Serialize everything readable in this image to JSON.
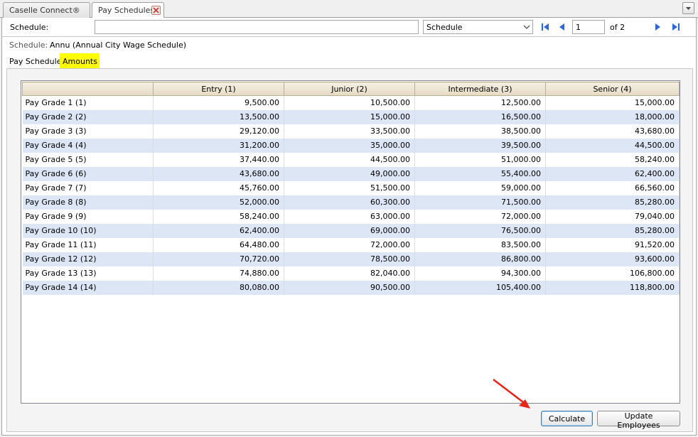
{
  "tabs": [
    {
      "label": "Caselle Connect®"
    },
    {
      "label": "Pay Schedules"
    }
  ],
  "toolbar": {
    "schedule_label": "Schedule:",
    "schedule_input_value": "",
    "search_field_value": "Schedule",
    "page_number": "1",
    "page_total": "of 2"
  },
  "info": {
    "schedule_label": "Schedule:",
    "schedule_value": "Annu (Annual City Wage Schedule)"
  },
  "inner_tabs": [
    {
      "label": "Pay Schedule"
    },
    {
      "label": "Amounts"
    }
  ],
  "grid": {
    "columns": [
      "",
      "Entry (1)",
      "Junior (2)",
      "Intermediate (3)",
      "Senior (4)"
    ],
    "rows": [
      [
        "Pay Grade 1 (1)",
        "9,500.00",
        "10,500.00",
        "12,500.00",
        "15,000.00"
      ],
      [
        "Pay Grade 2 (2)",
        "13,500.00",
        "15,000.00",
        "16,500.00",
        "18,000.00"
      ],
      [
        "Pay Grade 3 (3)",
        "29,120.00",
        "33,500.00",
        "38,500.00",
        "43,680.00"
      ],
      [
        "Pay Grade 4 (4)",
        "31,200.00",
        "35,000.00",
        "39,500.00",
        "44,500.00"
      ],
      [
        "Pay Grade 5 (5)",
        "37,440.00",
        "44,500.00",
        "51,000.00",
        "58,240.00"
      ],
      [
        "Pay Grade 6 (6)",
        "43,680.00",
        "49,000.00",
        "55,400.00",
        "62,400.00"
      ],
      [
        "Pay Grade 7 (7)",
        "45,760.00",
        "51,500.00",
        "59,000.00",
        "66,560.00"
      ],
      [
        "Pay Grade 8 (8)",
        "52,000.00",
        "60,300.00",
        "71,500.00",
        "85,280.00"
      ],
      [
        "Pay Grade 9 (9)",
        "58,240.00",
        "63,000.00",
        "72,000.00",
        "79,040.00"
      ],
      [
        "Pay Grade 10 (10)",
        "62,400.00",
        "69,000.00",
        "76,500.00",
        "85,280.00"
      ],
      [
        "Pay Grade 11 (11)",
        "64,480.00",
        "72,000.00",
        "83,500.00",
        "91,520.00"
      ],
      [
        "Pay Grade 12 (12)",
        "70,720.00",
        "78,500.00",
        "86,800.00",
        "93,600.00"
      ],
      [
        "Pay Grade 13 (13)",
        "74,880.00",
        "82,040.00",
        "94,300.00",
        "106,800.00"
      ],
      [
        "Pay Grade 14 (14)",
        "80,080.00",
        "90,500.00",
        "105,400.00",
        "118,800.00"
      ]
    ]
  },
  "buttons": {
    "calculate": "Calculate",
    "update_employees": "Update Employees"
  },
  "colors": {
    "active_tab_highlight": "#ffff00",
    "alt_row": "#dce6f5",
    "nav_icon": "#2a6ad1",
    "annotation_arrow": "#e8231a"
  },
  "icons": {
    "tab_close": "close-icon",
    "first": "first-page-icon",
    "prev": "previous-page-icon",
    "next": "next-page-icon",
    "last": "last-page-icon",
    "menu": "chevron-down-icon",
    "annotation": "red-arrow-annotation"
  }
}
